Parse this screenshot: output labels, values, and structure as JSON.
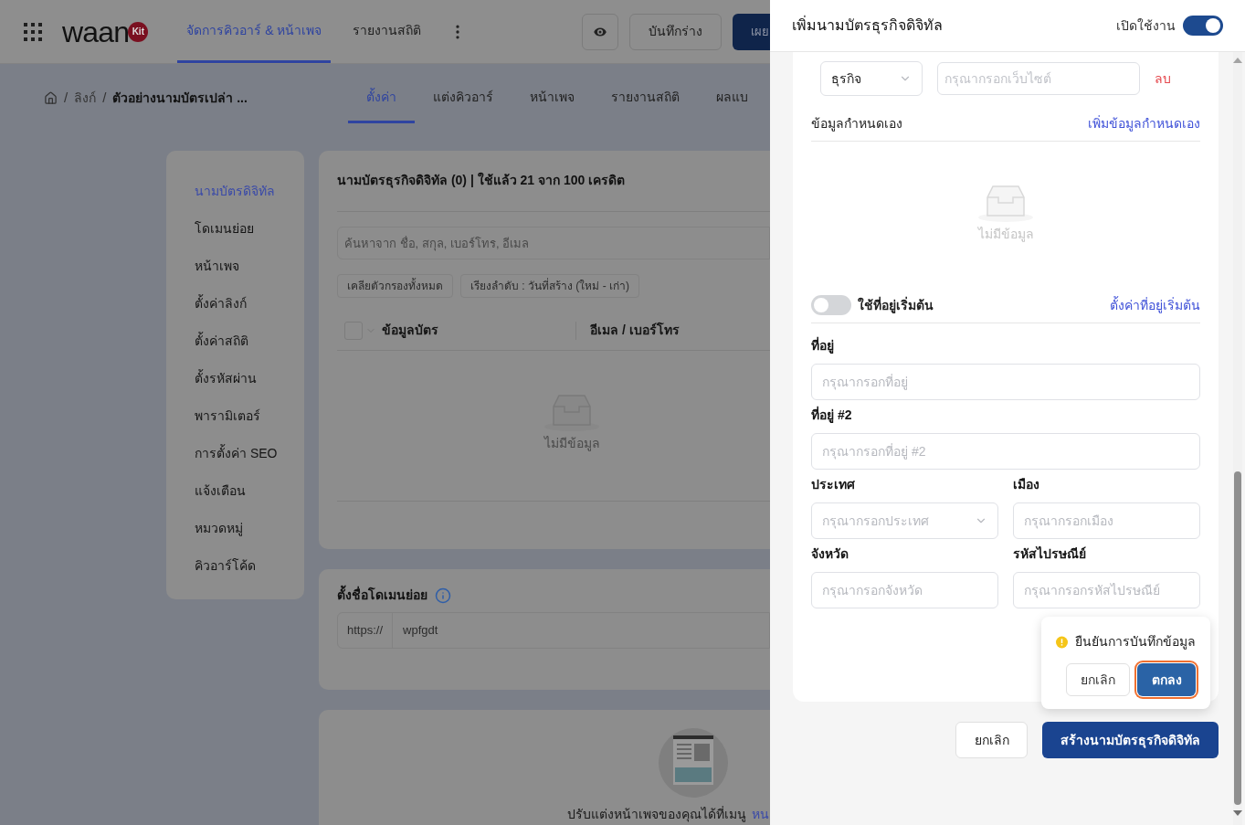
{
  "topbar": {
    "logo": {
      "text": "waan",
      "badge": "Kit"
    },
    "nav": [
      {
        "label": "จัดการคิวอาร์ & หน้าเพจ",
        "selected": true
      },
      {
        "label": "รายงานสถิติ",
        "selected": false
      }
    ],
    "draft_button": "บันทึกร่าง",
    "publish_button": "เผย"
  },
  "subbar": {
    "breadcrumb": [
      "ลิงก์",
      "ตัวอย่างนามบัตรเปล่า ..."
    ],
    "separators": [
      "/",
      "/"
    ],
    "tabs": [
      {
        "label": "ตั้งค่า",
        "selected": true
      },
      {
        "label": "แต่งคิวอาร์",
        "selected": false
      },
      {
        "label": "หน้าเพจ",
        "selected": false
      },
      {
        "label": "รายงานสถิติ",
        "selected": false
      },
      {
        "label": "ผลแบ",
        "selected": false
      }
    ]
  },
  "sidebar": {
    "items": [
      {
        "label": "นามบัตรดิจิทัล",
        "selected": true
      },
      {
        "label": "โดเมนย่อย",
        "selected": false
      },
      {
        "label": "หน้าเพจ",
        "selected": false
      },
      {
        "label": "ตั้งค่าลิงก์",
        "selected": false
      },
      {
        "label": "ตั้งค่าสถิติ",
        "selected": false
      },
      {
        "label": "ตั้งรหัสผ่าน",
        "selected": false
      },
      {
        "label": "พารามิเตอร์",
        "selected": false
      },
      {
        "label": "การตั้งค่า SEO",
        "selected": false
      },
      {
        "label": "แจ้งเตือน",
        "selected": false
      },
      {
        "label": "หมวดหมู่",
        "selected": false
      },
      {
        "label": "คิวอาร์โค้ด",
        "selected": false
      }
    ]
  },
  "cards_card": {
    "title": "นามบัตรธุรกิจดิจิทัล (0) | ใช้แล้ว 21 จาก 100 เครดิต",
    "search": {
      "placeholder": "ค้นหาจาก ชื่อ, สกุล, เบอร์โทร, อีเมล"
    },
    "filters": [
      "เคลียตัวกรองทั้งหมด",
      "เรียงลำดับ : วันที่สร้าง (ใหม่ - เก่า)"
    ],
    "table": {
      "select_all": {
        "checked": false
      },
      "columns": [
        "ข้อมูลบัตร",
        "อีเมล / เบอร์โทร"
      ]
    },
    "empty": "ไม่มีข้อมูล"
  },
  "subdomain_card": {
    "title": "ตั้งชื่อโดเมนย่อย",
    "prefix": "https://",
    "value": "wpfgdt"
  },
  "page_card": {
    "text": "ปรับแต่งหน้าเพจของคุณได้ที่เมนู",
    "link": "หน"
  },
  "drawer": {
    "title": "เพิ่มนามบัตรธุรกิจดิจิทัล",
    "enabled_label": "เปิดใช้งาน",
    "enabled": true,
    "website_row": {
      "type_value": "ธุรกิจ",
      "placeholder": "กรุณากรอกเว็บไซต์",
      "delete": "ลบ"
    },
    "custom": {
      "label": "ข้อมูลกำหนดเอง",
      "add_link": "เพิ่มข้อมูลกำหนดเอง",
      "empty": "ไม่มีข้อมูล"
    },
    "default_address": {
      "on": false,
      "label": "ใช้ที่อยู่เริ่มต้น",
      "link": "ตั้งค่าที่อยู่เริ่มต้น"
    },
    "field_rows": [
      [
        {
          "kind": "text",
          "label": "ที่อยู่",
          "placeholder": "กรุณากรอกที่อยู่"
        }
      ],
      [
        {
          "kind": "text",
          "label": "ที่อยู่ #2",
          "placeholder": "กรุณากรอกที่อยู่ #2"
        }
      ],
      [
        {
          "kind": "select",
          "label": "ประเทศ",
          "placeholder": "กรุณากรอกประเทศ"
        },
        {
          "kind": "text",
          "label": "เมือง",
          "placeholder": "กรุณากรอกเมือง"
        }
      ],
      [
        {
          "kind": "text",
          "label": "จังหวัด",
          "placeholder": "กรุณากรอกจังหวัด"
        },
        {
          "kind": "text",
          "label": "รหัสไปรษณีย์",
          "placeholder": "กรุณากรอกรหัสไปรษณีย์"
        }
      ]
    ],
    "confirm": {
      "message": "ยืนยันการบันทึกข้อมูล",
      "cancel": "ยกเลิก",
      "ok": "ตกลง"
    },
    "footer": {
      "cancel": "ยกเลิก",
      "submit": "สร้างนามบัตรธุรกิจดิจิทัล"
    }
  }
}
